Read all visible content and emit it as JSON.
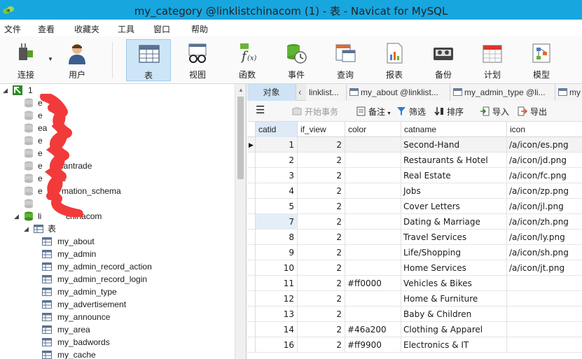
{
  "window": {
    "title": "my_category @linklistchinacom (1) - 表 - Navicat for MySQL"
  },
  "menubar": [
    "文件",
    "查看",
    "收藏夹",
    "工具",
    "窗口",
    "帮助"
  ],
  "toolbar": [
    {
      "label": "连接",
      "icon": "plug-icon"
    },
    {
      "label": "用户",
      "icon": "user-icon"
    },
    {
      "label": "表",
      "icon": "table-icon"
    },
    {
      "label": "视图",
      "icon": "view-glasses-icon"
    },
    {
      "label": "函数",
      "icon": "function-icon"
    },
    {
      "label": "事件",
      "icon": "event-clock-icon"
    },
    {
      "label": "查询",
      "icon": "query-icon"
    },
    {
      "label": "报表",
      "icon": "report-icon"
    },
    {
      "label": "备份",
      "icon": "backup-tape-icon"
    },
    {
      "label": "计划",
      "icon": "calendar-icon"
    },
    {
      "label": "模型",
      "icon": "model-icon"
    }
  ],
  "tree": {
    "connection": "1",
    "partial_items": [
      "e",
      "e",
      "ea",
      "e",
      "e",
      "e",
      "e",
      "e"
    ],
    "visible_fragments": [
      "",
      "",
      "",
      "",
      "a",
      "iantrade",
      "e",
      "mation_schema"
    ],
    "open_db_fragment": "chinacom",
    "tables_group": "表",
    "tables": [
      "my_about",
      "my_admin",
      "my_admin_record_action",
      "my_admin_record_login",
      "my_admin_type",
      "my_advertisement",
      "my_announce",
      "my_area",
      "my_badwords",
      "my_cache"
    ]
  },
  "tabs": [
    {
      "label": "对象"
    },
    {
      "label": "linklist..."
    },
    {
      "label": "my_about @linklist..."
    },
    {
      "label": "my_admin_type @li..."
    },
    {
      "label": "my"
    }
  ],
  "objbar": {
    "menu": "☰",
    "begin_tx": "开始事务",
    "memo": "备注",
    "filter": "筛选",
    "sort": "排序",
    "import": "导入",
    "export": "导出"
  },
  "grid": {
    "columns": [
      "catid",
      "if_view",
      "color",
      "catname",
      "icon"
    ],
    "rows": [
      [
        "1",
        "2",
        "",
        "Second-Hand",
        "/a/icon/es.png"
      ],
      [
        "2",
        "2",
        "",
        "Restaurants & Hotel",
        "/a/icon/jd.png"
      ],
      [
        "3",
        "2",
        "",
        "Real Estate",
        "/a/icon/fc.png"
      ],
      [
        "4",
        "2",
        "",
        "Jobs",
        "/a/icon/zp.png"
      ],
      [
        "5",
        "2",
        "",
        "Cover Letters",
        "/a/icon/jl.png"
      ],
      [
        "7",
        "2",
        "",
        "Dating & Marriage",
        "/a/icon/zh.png"
      ],
      [
        "8",
        "2",
        "",
        "Travel Services",
        "/a/icon/ly.png"
      ],
      [
        "9",
        "2",
        "",
        "Life/Shopping",
        "/a/icon/sh.png"
      ],
      [
        "10",
        "2",
        "",
        "Home Services",
        "/a/icon/jt.png"
      ],
      [
        "11",
        "2",
        "#ff0000",
        "Vehicles & Bikes",
        ""
      ],
      [
        "12",
        "2",
        "",
        "Home & Furniture",
        ""
      ],
      [
        "13",
        "2",
        "",
        "Baby & Children",
        ""
      ],
      [
        "14",
        "2",
        "#46a200",
        "Clothing & Apparel",
        ""
      ],
      [
        "16",
        "2",
        "#ff9900",
        "Electronics & IT",
        ""
      ]
    ]
  }
}
